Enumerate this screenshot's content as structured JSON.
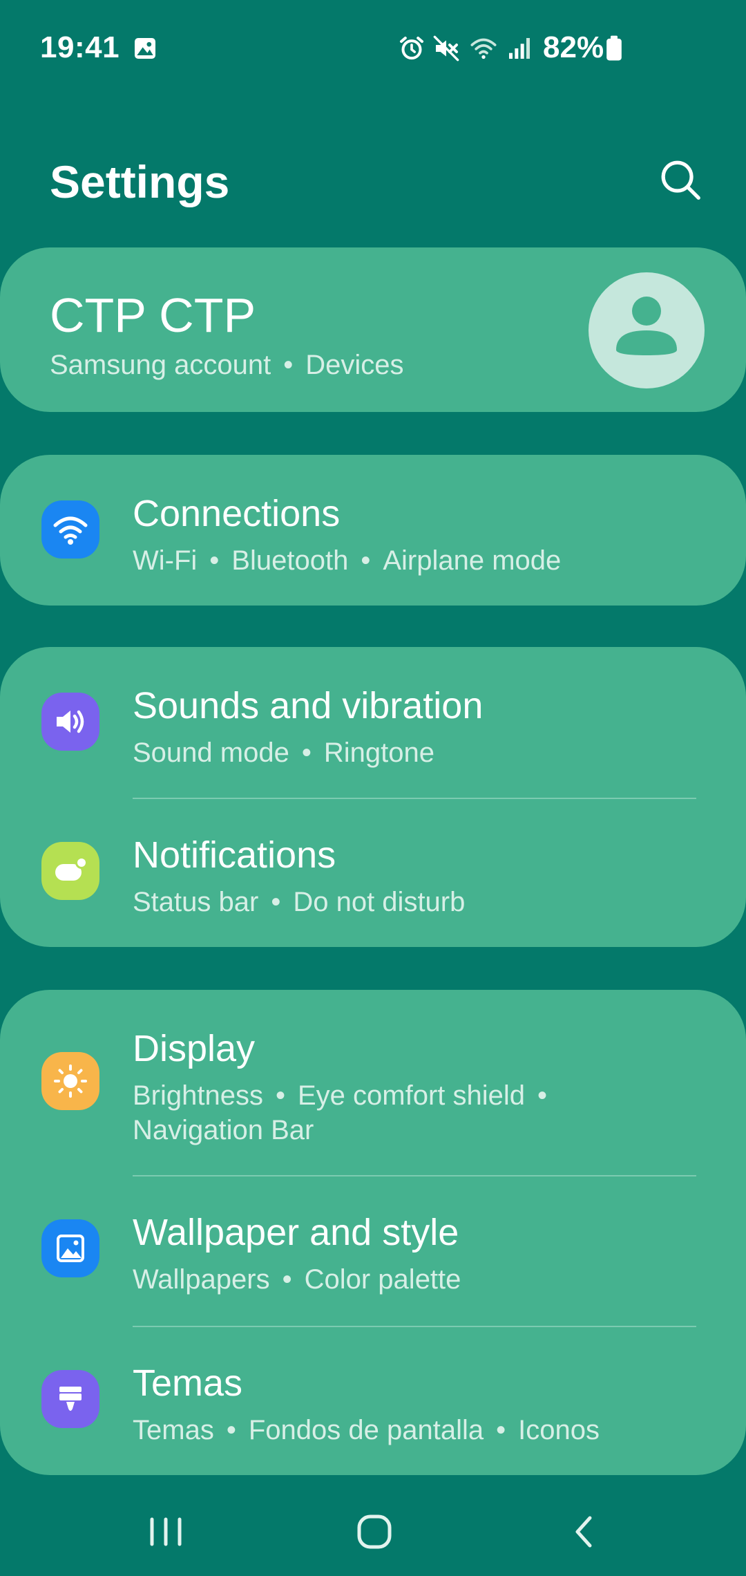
{
  "status_bar": {
    "time": "19:41",
    "battery": "82%",
    "icons": [
      "image-icon",
      "alarm-icon",
      "mute-icon",
      "wifi-icon",
      "signal-icon",
      "battery-icon"
    ]
  },
  "header": {
    "title": "Settings"
  },
  "account": {
    "name": "CTP CTP",
    "links": [
      "Samsung account",
      "Devices"
    ]
  },
  "items": [
    {
      "title": "Connections",
      "sub": [
        "Wi-Fi",
        "Bluetooth",
        "Airplane mode"
      ],
      "icon": "wifi-icon",
      "color": "#1a86f2"
    },
    {
      "title": "Sounds and vibration",
      "sub": [
        "Sound mode",
        "Ringtone"
      ],
      "icon": "speaker-icon",
      "color": "#7a63ee"
    },
    {
      "title": "Notifications",
      "sub": [
        "Status bar",
        "Do not disturb"
      ],
      "icon": "notification-icon",
      "color": "#b5e052"
    },
    {
      "title": "Display",
      "sub": [
        "Brightness",
        "Eye comfort shield"
      ],
      "sub2": "Navigation Bar",
      "icon": "sun-icon",
      "color": "#f8b54a"
    },
    {
      "title": "Wallpaper and style",
      "sub": [
        "Wallpapers",
        "Color palette"
      ],
      "icon": "image-icon",
      "color": "#1a86f2"
    },
    {
      "title": "Temas",
      "sub": [
        "Temas",
        "Fondos de pantalla",
        "Iconos"
      ],
      "icon": "brush-icon",
      "color": "#7a63ee"
    }
  ],
  "nav": [
    "recents-icon",
    "home-icon",
    "back-icon"
  ]
}
